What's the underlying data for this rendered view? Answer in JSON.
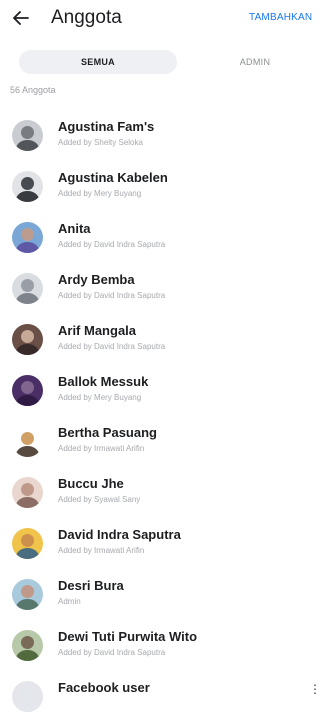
{
  "header": {
    "title": "Anggota",
    "add_label": "TAMBAHKAN"
  },
  "tabs": [
    {
      "label": "SEMUA",
      "selected": true
    },
    {
      "label": "ADMIN",
      "selected": false
    }
  ],
  "member_count": "56 Anggota",
  "members": [
    {
      "name": "Agustina Fam's",
      "sub": "Added by Shelty Seloka",
      "avatar_bg": "#c9cdd2",
      "face": "#6b6f74",
      "body": "#3d4146"
    },
    {
      "name": "Agustina Kabelen",
      "sub": "Added by Mery Buyang",
      "avatar_bg": "#e1e3e6",
      "face": "#2b2f36",
      "body": "#1a1d22"
    },
    {
      "name": "Anita",
      "sub": "Added by David Indra Saputra",
      "avatar_bg": "#7aa7d6",
      "face": "#c89a83",
      "body": "#5b4a9c"
    },
    {
      "name": "Ardy Bemba",
      "sub": "Added by David Indra Saputra",
      "avatar_bg": "#d9dde2",
      "face": "#8e949b",
      "body": "#6c737b"
    },
    {
      "name": "Arif Mangala",
      "sub": "Added by David Indra Saputra",
      "avatar_bg": "#6a4f47",
      "face": "#d7b8a6",
      "body": "#2e2323"
    },
    {
      "name": "Ballok Messuk",
      "sub": "Added by Mery Buyang",
      "avatar_bg": "#4a2f66",
      "face": "#8b6e96",
      "body": "#2b1840"
    },
    {
      "name": "Bertha Pasuang",
      "sub": "Added by Irmawati Arifin",
      "avatar_bg": "#ffffff",
      "face": "#c98f4c",
      "body": "#3b2a1d"
    },
    {
      "name": "Buccu Jhe",
      "sub": "Added by Syawal Sany",
      "avatar_bg": "#e9d6cf",
      "face": "#b78e7e",
      "body": "#7a5a52"
    },
    {
      "name": "David Indra Saputra",
      "sub": "Added by Irmawati Arifin",
      "avatar_bg": "#f0c34a",
      "face": "#c7874e",
      "body": "#2d5f8a"
    },
    {
      "name": "Desri Bura",
      "sub": "Admin",
      "avatar_bg": "#a9c9dc",
      "face": "#c4917c",
      "body": "#4a6a5a"
    },
    {
      "name": "Dewi Tuti Purwita Wito",
      "sub": "Added by David Indra Saputra",
      "avatar_bg": "#b7c9a8",
      "face": "#6e5a49",
      "body": "#3f5a2c"
    },
    {
      "name": "Facebook user",
      "sub": "",
      "avatar_bg": "#e4e6eb",
      "face": "#e4e6eb",
      "body": "#e4e6eb"
    }
  ]
}
